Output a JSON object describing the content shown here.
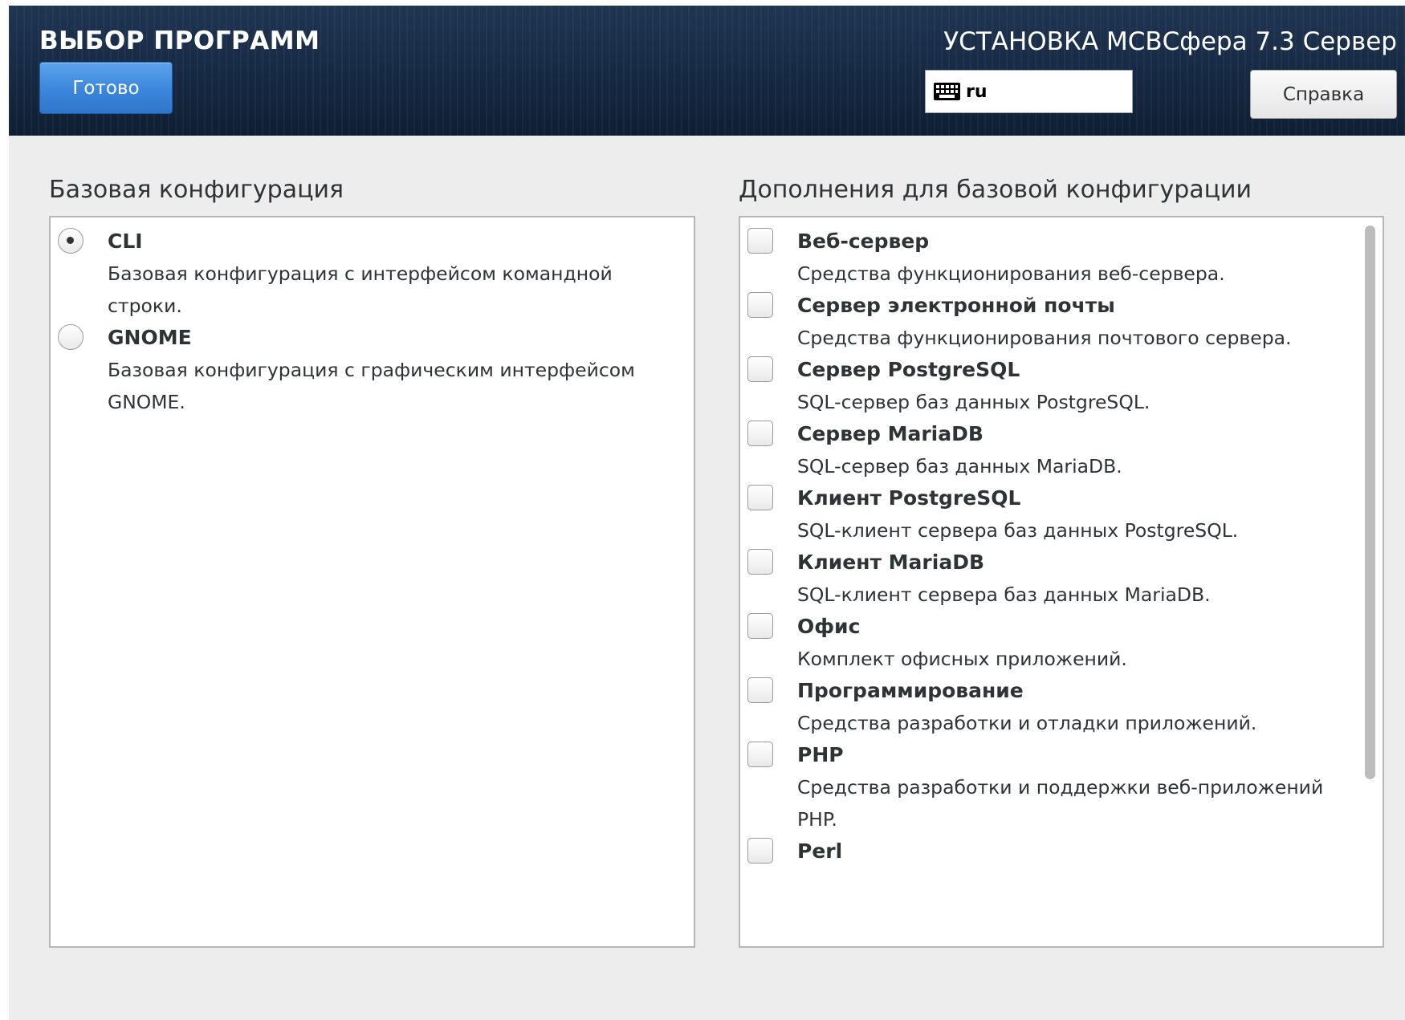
{
  "header": {
    "spoke_title": "ВЫБОР ПРОГРАММ",
    "done_label": "Готово",
    "product_title": "УСТАНОВКА МСВСфера 7.3 Сервер",
    "keyboard_layout": "ru",
    "help_label": "Справка",
    "icons": {
      "keyboard": "keyboard-icon"
    }
  },
  "base_environment": {
    "heading": "Базовая конфигурация",
    "selected": "CLI",
    "items": [
      {
        "name": "CLI",
        "description": "Базовая конфигурация с интерфейсом командной строки.",
        "checked": true
      },
      {
        "name": "GNOME",
        "description": "Базовая конфигурация с графическим интерфейсом GNOME.",
        "checked": false
      }
    ]
  },
  "addons": {
    "heading": "Дополнения для базовой конфигурации",
    "items": [
      {
        "name": "Веб-сервер",
        "description": "Средства функционирования веб-сервера.",
        "checked": false
      },
      {
        "name": "Сервер электронной почты",
        "description": "Средства функционирования почтового сервера.",
        "checked": false
      },
      {
        "name": "Сервер PostgreSQL",
        "description": "SQL-сервер баз данных PostgreSQL.",
        "checked": false
      },
      {
        "name": "Сервер MariaDB",
        "description": "SQL-сервер баз данных MariaDB.",
        "checked": false
      },
      {
        "name": "Клиент PostgreSQL",
        "description": "SQL-клиент сервера баз данных PostgreSQL.",
        "checked": false
      },
      {
        "name": "Клиент MariaDB",
        "description": "SQL-клиент сервера баз данных MariaDB.",
        "checked": false
      },
      {
        "name": "Офис",
        "description": "Комплект офисных приложений.",
        "checked": false
      },
      {
        "name": "Программирование",
        "description": "Средства разработки и отладки приложений.",
        "checked": false
      },
      {
        "name": "PHP",
        "description": "Средства разработки и поддержки веб-приложений PHP.",
        "checked": false
      },
      {
        "name": "Perl",
        "description": "",
        "checked": false
      }
    ]
  },
  "colors": {
    "header_bg": "#172a44",
    "accent": "#3a86dc",
    "window_bg": "#ededed"
  }
}
